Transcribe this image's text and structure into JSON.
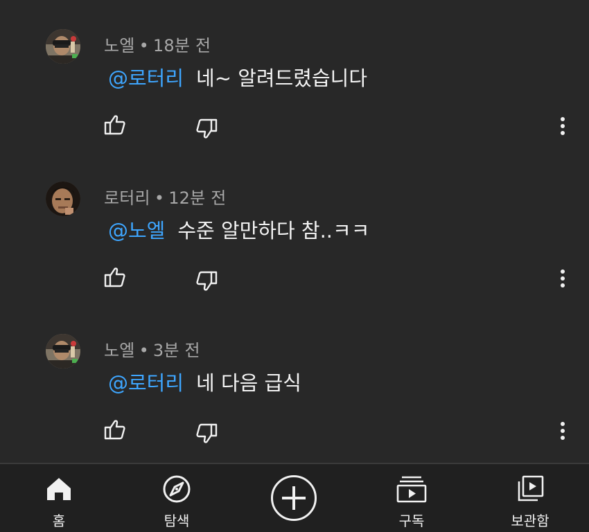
{
  "comments": [
    {
      "author": "노엘",
      "time": "18분 전",
      "mention": "@로터리",
      "text": "네~ 알려드렸습니다",
      "avatar": "noel-avatar"
    },
    {
      "author": "로터리",
      "time": "12분 전",
      "mention": "@노엘",
      "text": "수준 알만하다 참..ㅋㅋ",
      "avatar": "rotary-avatar"
    },
    {
      "author": "노엘",
      "time": "3분 전",
      "mention": "@로터리",
      "text": "네 다음 급식",
      "avatar": "noel-avatar"
    }
  ],
  "separator": "•",
  "nav": {
    "home": "홈",
    "explore": "탐색",
    "subscriptions": "구독",
    "library": "보관함"
  },
  "icons": {
    "like": "thumbs-up-icon",
    "dislike": "thumbs-down-icon",
    "more": "more-vertical-icon",
    "home": "home-icon",
    "explore": "compass-icon",
    "create": "plus-icon",
    "subscriptions": "subscriptions-icon",
    "library": "library-icon"
  },
  "colors": {
    "background": "#282828",
    "navbar": "#202020",
    "mention": "#3ea6ff",
    "meta": "#a8a8a8",
    "text": "#f4f4f4"
  }
}
